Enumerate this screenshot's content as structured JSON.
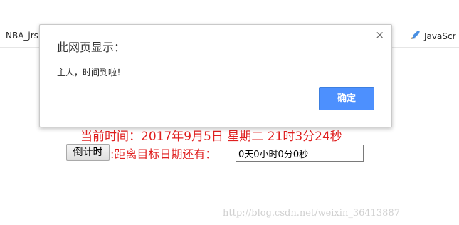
{
  "bookmarks": {
    "left_label": "NBA_jrs",
    "right_label": "JavaScr",
    "separator": "·"
  },
  "dialog": {
    "title": "此网页显示：",
    "message": "主人，时间到啦！",
    "ok_label": "确定",
    "close_glyph": "×",
    "accent_color": "#4d90fe"
  },
  "main": {
    "current_time": "当前时间：2017年9月5日 星期二 21时3分24秒",
    "countdown_button_label": "倒计时",
    "countdown_label": ":距离目标日期还有：",
    "countdown_value": "0天0小时0分0秒",
    "text_color": "#e02020"
  },
  "watermark": "http://blog.csdn.net/weixin_36413887"
}
